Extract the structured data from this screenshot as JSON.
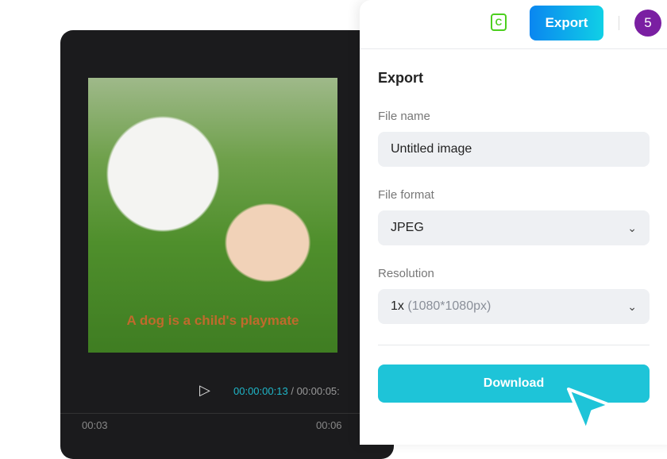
{
  "editor": {
    "caption": "A dog is a child's playmate",
    "current_time": "00:00:00:13",
    "separator": "/",
    "total_time": "00:00:05:",
    "ticks": [
      "00:03",
      "00:06"
    ]
  },
  "topbar": {
    "export_label": "Export",
    "avatar_label": "5",
    "shield_letter": "C"
  },
  "export": {
    "title": "Export",
    "file_name_label": "File name",
    "file_name_value": "Untitled image",
    "file_format_label": "File format",
    "file_format_value": "JPEG",
    "resolution_label": "Resolution",
    "resolution_value": "1x",
    "resolution_detail": "(1080*1080px)",
    "download_label": "Download"
  },
  "colors": {
    "accent": "#1ec4d8",
    "avatar": "#7a1fa2",
    "shield": "#4ccf1e"
  }
}
